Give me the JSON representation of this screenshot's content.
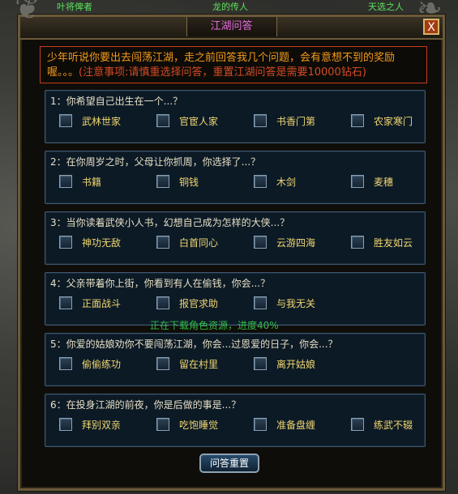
{
  "top_names": [
    "叶将俾者",
    "龙的传人",
    "天选之人"
  ],
  "window": {
    "title": "江湖问答",
    "close_label": "X"
  },
  "notice": {
    "text": "少年听说你要出去闯荡江湖，走之前回答我几个问题，会有意想不到的奖励喔。。。",
    "warning": "(注意事项:请慎重选择问答，重置江湖问答是需要10000钻石)"
  },
  "questions": [
    {
      "text": "1：你希望自己出生在一个...？",
      "options": [
        "武林世家",
        "官宦人家",
        "书香门第",
        "农家寒门"
      ]
    },
    {
      "text": "2：在你周岁之时，父母让你抓周，你选择了...？",
      "options": [
        "书籍",
        "铜钱",
        "木剑",
        "麦穗"
      ]
    },
    {
      "text": "3：当你读着武侠小人书，幻想自己成为怎样的大侠...？",
      "options": [
        "神功无敌",
        "白首同心",
        "云游四海",
        "胜友如云"
      ]
    },
    {
      "text": "4：父亲带着你上街，你看到有人在偷钱，你会...？",
      "options": [
        "正面战斗",
        "报官求助",
        "与我无关"
      ]
    },
    {
      "text": "5：你爱的姑娘劝你不要闯荡江湖，你会...",
      "text_suffix": "过恩爱的日子，你会...？",
      "options": [
        "偷偷练功",
        "留在村里",
        "离开姑娘"
      ]
    },
    {
      "text": "6：在投身江湖的前夜，你是后做的事是...？",
      "options": [
        "拜别双亲",
        "吃饱睡觉",
        "准备盘缠",
        "练武不辍"
      ]
    }
  ],
  "loading_overlay": "正在下载角色资源，进度40%",
  "reset_button": "问答重置"
}
